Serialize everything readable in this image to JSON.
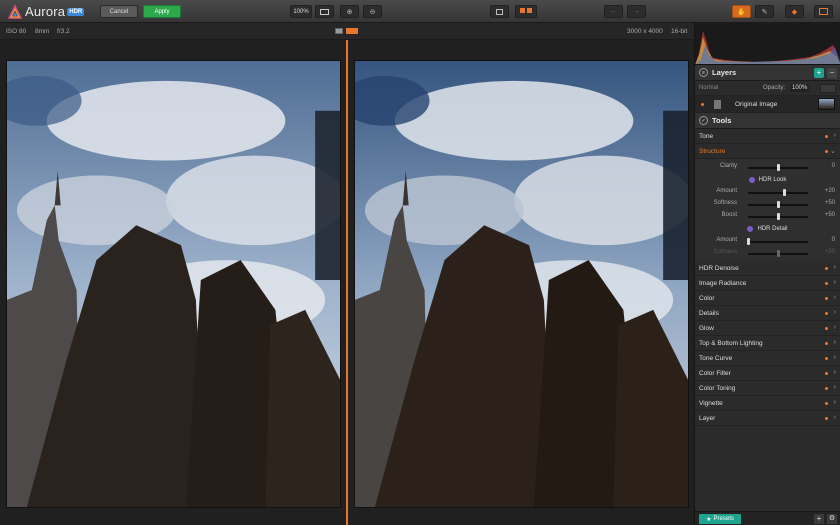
{
  "app": {
    "name": "Aurora",
    "badge": "HDR"
  },
  "toolbar": {
    "cancel_label": "Cancel",
    "apply_label": "Apply",
    "zoom_level": "100%"
  },
  "info": {
    "iso": "ISO 80",
    "focal": "8mm",
    "aperture": "f/3.2",
    "dimensions": "3000 x 4000",
    "bit_depth": "16-bit"
  },
  "layers": {
    "title": "Layers",
    "blend_mode": "Normal",
    "opacity_label": "Opacity:",
    "opacity_value": "100%",
    "items": [
      {
        "label": "Original Image"
      }
    ]
  },
  "tools": {
    "title": "Tools",
    "tone_label": "Tone",
    "structure_label": "Structure",
    "clarity": {
      "label": "Clarity",
      "value": "0",
      "level": 0.5
    },
    "hdr_look": {
      "title": "HDR Look",
      "sliders": [
        {
          "label": "Amount",
          "value": "+20",
          "level": 0.6
        },
        {
          "label": "Softness",
          "value": "+50",
          "level": 0.5
        },
        {
          "label": "Boost",
          "value": "+50",
          "level": 0.5
        }
      ]
    },
    "hdr_detail": {
      "title": "HDR Detail",
      "sliders": [
        {
          "label": "Amount",
          "value": "0",
          "level": 0.0
        },
        {
          "label": "Softness",
          "value": "+50",
          "level": 0.5,
          "disabled": true
        }
      ]
    },
    "sections": [
      "HDR Denoise",
      "Image Radiance",
      "Color",
      "Details",
      "Glow",
      "Top & Bottom Lighting",
      "Tone Curve",
      "Color Filter",
      "Color Toning",
      "Vignette",
      "Layer"
    ]
  },
  "presets_label": "Presets",
  "colors": {
    "accent_orange": "#e8762c",
    "apply_green": "#2aa84a",
    "presets_teal": "#1ea38f",
    "hdr_purple": "#7a5cc8"
  }
}
